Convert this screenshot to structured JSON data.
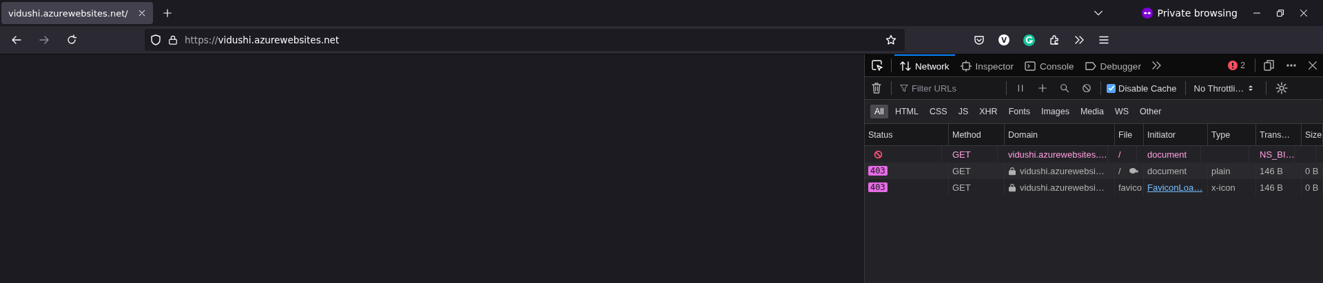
{
  "tab": {
    "title": "vidushi.azurewebsites.net/",
    "selected": true
  },
  "url": {
    "scheme": "https://",
    "host": "vidushi.azurewebsites.net"
  },
  "private_label": "Private browsing",
  "avatar_letter": "V",
  "devtools": {
    "tabs": [
      {
        "label": "Network",
        "kind": "network",
        "selected": true
      },
      {
        "label": "Inspector",
        "kind": "inspector",
        "selected": false
      },
      {
        "label": "Console",
        "kind": "console",
        "selected": false
      },
      {
        "label": "Debugger",
        "kind": "debugger",
        "selected": false
      }
    ],
    "error_count": "2",
    "filter": {
      "placeholder": "Filter URLs"
    },
    "disable_cache": {
      "label": "Disable Cache",
      "checked": true
    },
    "throttling": "No Throttli…",
    "types": [
      {
        "label": "All",
        "selected": true
      },
      {
        "label": "HTML",
        "selected": false
      },
      {
        "label": "CSS",
        "selected": false
      },
      {
        "label": "JS",
        "selected": false
      },
      {
        "label": "XHR",
        "selected": false
      },
      {
        "label": "Fonts",
        "selected": false
      },
      {
        "label": "Images",
        "selected": false
      },
      {
        "label": "Media",
        "selected": false
      },
      {
        "label": "WS",
        "selected": false
      },
      {
        "label": "Other",
        "selected": false
      }
    ],
    "table": {
      "columns": [
        "Status",
        "Method",
        "Domain",
        "File",
        "Initiator",
        "Type",
        "Trans…",
        "Size"
      ],
      "rows": [
        {
          "kind": "blocked",
          "error": true,
          "secure": false,
          "slow": false,
          "initiator_link": false,
          "method": "GET",
          "domain": "vidushi.azurewebsites.…",
          "file": "/",
          "initiator": "document",
          "transferred": "NS_BI…"
        },
        {
          "kind": "code",
          "status": "403",
          "error": false,
          "secure": true,
          "slow": true,
          "initiator_link": false,
          "method": "GET",
          "domain": "vidushi.azurewebsi…",
          "file": "/",
          "initiator": "document",
          "type": "plain",
          "transferred": "146 B",
          "size": "0 B"
        },
        {
          "kind": "code",
          "status": "403",
          "error": false,
          "secure": true,
          "slow": false,
          "initiator_link": true,
          "method": "GET",
          "domain": "vidushi.azurewebsi…",
          "file": "favico",
          "initiator": "FaviconLoa…",
          "type": "x-icon",
          "transferred": "146 B",
          "size": "0 B"
        }
      ]
    }
  }
}
